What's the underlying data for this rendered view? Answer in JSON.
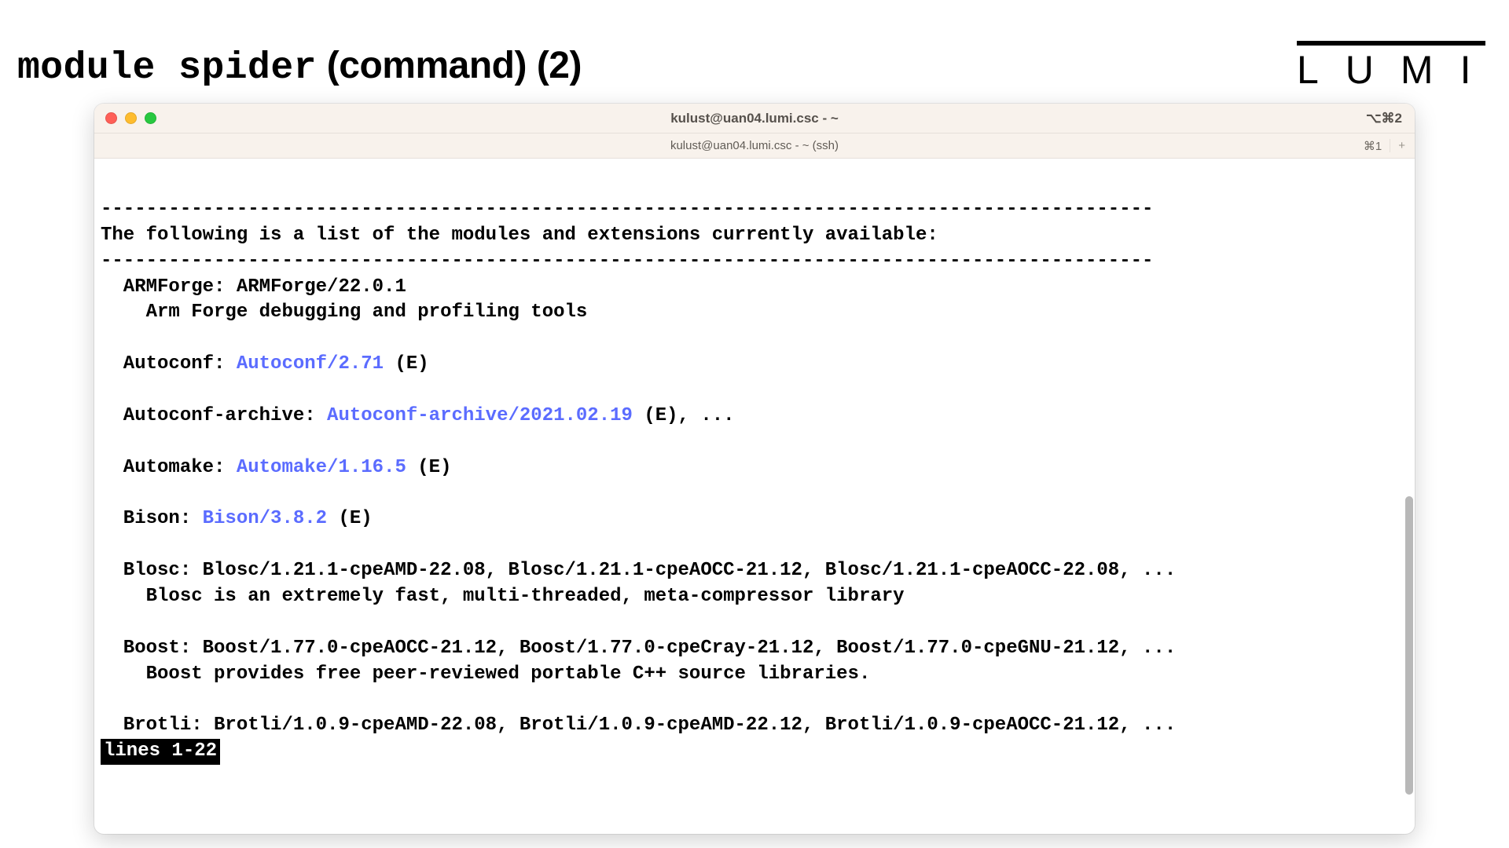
{
  "slide": {
    "title_cmd": "module spider",
    "title_paren": " (command) (2)",
    "logo": "LUMI"
  },
  "window": {
    "title": "kulust@uan04.lumi.csc - ~",
    "title_shortcut": "⌥⌘2",
    "tab_title": "kulust@uan04.lumi.csc - ~ (ssh)",
    "tab_shortcut": "⌘1",
    "plus": "+"
  },
  "terminal": {
    "hr": "---------------------------------------------------------------------------------------------",
    "intro": "The following is a list of the modules and extensions currently available:",
    "modules": {
      "armforge": {
        "label": "  ARMForge: ARMForge/22.0.1",
        "desc": "    Arm Forge debugging and profiling tools"
      },
      "autoconf": {
        "label": "  Autoconf: ",
        "link": "Autoconf/2.71",
        "suffix": " (E)"
      },
      "autoconf_archive": {
        "label": "  Autoconf-archive: ",
        "link": "Autoconf-archive/2021.02.19",
        "suffix": " (E), ..."
      },
      "automake": {
        "label": "  Automake: ",
        "link": "Automake/1.16.5",
        "suffix": " (E)"
      },
      "bison": {
        "label": "  Bison: ",
        "link": "Bison/3.8.2",
        "suffix": " (E)"
      },
      "blosc": {
        "label": "  Blosc: Blosc/1.21.1-cpeAMD-22.08, Blosc/1.21.1-cpeAOCC-21.12, Blosc/1.21.1-cpeAOCC-22.08, ...",
        "desc": "    Blosc is an extremely fast, multi-threaded, meta-compressor library"
      },
      "boost": {
        "label": "  Boost: Boost/1.77.0-cpeAOCC-21.12, Boost/1.77.0-cpeCray-21.12, Boost/1.77.0-cpeGNU-21.12, ...",
        "desc": "    Boost provides free peer-reviewed portable C++ source libraries."
      },
      "brotli": {
        "label": "  Brotli: Brotli/1.0.9-cpeAMD-22.08, Brotli/1.0.9-cpeAMD-22.12, Brotli/1.0.9-cpeAOCC-21.12, ..."
      }
    },
    "pager": "lines 1-22"
  }
}
